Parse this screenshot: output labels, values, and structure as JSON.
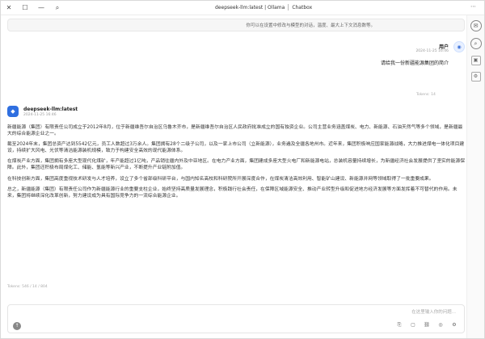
{
  "window": {
    "app_name": "Chatbox",
    "title_left": "deepseek-llm:latest | Ollama",
    "controls": [
      "close",
      "maximize",
      "minimize"
    ]
  },
  "notice": {
    "text": "你可以在设置中修改与模型的对话，温度、最大上下文消息数等。"
  },
  "user_message": {
    "name": "用户",
    "time": "2024-11-25 16:46",
    "text": "请给我一份新疆能源集团的简介"
  },
  "tokens_top": "Tokens: 14",
  "assistant": {
    "name": "deepseek-llm:latest",
    "time": "2024-11-25 16:46",
    "paragraphs": [
      "新疆能源（集团）有限责任公司成立于2012年8月，位于新疆维吾尔自治区乌鲁木齐市，是新疆维吾尔自治区人民政府批准成立的国有独资企业。公司主营业务涵盖煤炭、电力、新能源、石油天然气等多个领域，是新疆最大的综合能源企业之一。",
      "截至2024年末，集团总资产达到5542亿元，员工人数超过3万余人。集团拥有28个二级子公司，以及一家上市公司（立新能源），业务遍及全疆各地州市。近年来，集团积极响应国家能源战略，大力推进煤电一体化项目建设，持续扩大风电、光伏等清洁能源装机规模，致力于构建安全高效的现代能源体系。",
      "在煤炭产业方面，集团拥有多座大型现代化煤矿，年产能超过1亿吨，产品销往疆内外及中亚地区。在电力产业方面，集团建成多座大型火电厂和新能源电站，总装机容量持续增长，为新疆经济社会发展提供了坚实的能源保障。此外，集团还积极布局煤化工、储能、氢能等新兴产业，不断提升产业链附加值。",
      "在科技创新方面，集团高度重视技术研发与人才培养，设立了多个省部级科研平台，与国内知名高校和科研院所开展深度合作，在煤炭清洁高效利用、智能矿山建设、新能源并网等领域取得了一批重要成果。",
      "总之，新疆能源（集团）有限责任公司作为新疆能源行业的重要支柱企业，始终坚持高质量发展理念，积极践行社会责任，在保障区域能源安全、推动产业转型升级和促进地方经济发展等方面发挥着不可替代的作用。未来，集团将继续深化改革创新，努力建设成为具有国际竞争力的一流综合能源企业。"
    ]
  },
  "tokens_bottom": "Tokens: 546 / 14 / 804",
  "input": {
    "placeholder": "在这里输入你的问题..."
  },
  "sidebar": {
    "icons": [
      "chat-icon",
      "search-icon",
      "image-icon",
      "settings-icon"
    ]
  }
}
